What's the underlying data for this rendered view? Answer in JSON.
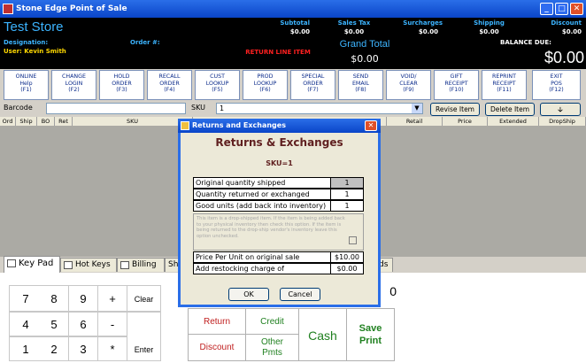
{
  "window": {
    "title": "Stone Edge Point of Sale"
  },
  "header": {
    "store_name": "Test Store",
    "designation_label": "Designation:",
    "order_label": "Order #:",
    "user": "User: Kevin Smith",
    "return_line": "RETURN LINE ITEM",
    "totals": [
      {
        "label": "Subtotal",
        "value": "$0.00"
      },
      {
        "label": "Sales Tax",
        "value": "$0.00"
      },
      {
        "label": "Surcharges",
        "value": "$0.00"
      },
      {
        "label": "Shipping",
        "value": "$0.00"
      },
      {
        "label": "Discount",
        "value": "$0.00"
      }
    ],
    "grand_total_label": "Grand Total",
    "grand_total_value": "$0.00",
    "balance_due_label": "BALANCE DUE:",
    "balance_due_value": "$0.00"
  },
  "function_keys": [
    {
      "l1": "ONLINE",
      "l2": "Help",
      "l3": "(F1)"
    },
    {
      "l1": "CHANGE",
      "l2": "LOGIN",
      "l3": "(F2)"
    },
    {
      "l1": "HOLD",
      "l2": "ORDER",
      "l3": "(F3)"
    },
    {
      "l1": "RECALL",
      "l2": "ORDER",
      "l3": "(F4)"
    },
    {
      "l1": "CUST",
      "l2": "LOOKUP",
      "l3": "(F5)"
    },
    {
      "l1": "PROD",
      "l2": "LOOKUP",
      "l3": "(F6)"
    },
    {
      "l1": "SPECIAL",
      "l2": "ORDER",
      "l3": "(F7)"
    },
    {
      "l1": "SEND",
      "l2": "EMAIL",
      "l3": "(F8)"
    },
    {
      "l1": "VOID/",
      "l2": "CLEAR",
      "l3": "(F9)"
    },
    {
      "l1": "GIFT",
      "l2": "RECEIPT",
      "l3": "(F10)"
    },
    {
      "l1": "REPRINT",
      "l2": "RECEIPT",
      "l3": "(F11)"
    },
    {
      "l1": "EXIT",
      "l2": "POS",
      "l3": "(F12)"
    }
  ],
  "entry": {
    "barcode_label": "Barcode",
    "sku_label": "SKU",
    "sku_value": "1",
    "revise_button": "Revise Item",
    "delete_button": "Delete Item",
    "arrow_glyph": "🡣"
  },
  "grid": {
    "columns": [
      "Ord",
      "Ship",
      "BO",
      "Ret",
      "SKU",
      "",
      "Retail",
      "Price",
      "Extended",
      "DropShip"
    ]
  },
  "tabs": [
    "Key Pad",
    "Hot Keys",
    "Billing",
    "Sh",
    "ds"
  ],
  "keypad": {
    "keys": [
      "7",
      "8",
      "9",
      "+",
      "4",
      "5",
      "6",
      "-",
      "1",
      "2",
      "3",
      "*"
    ],
    "clear": "Clear",
    "enter": "Enter",
    "display": "0"
  },
  "actions": {
    "return": "Return",
    "credit": "Credit",
    "discount": "Discount",
    "other_l1": "Other",
    "other_l2": "Pmts",
    "cash": "Cash",
    "save_l1": "Save",
    "save_l2": "Print"
  },
  "dialog": {
    "title": "Returns and Exchanges",
    "heading": "Returns & Exchanges",
    "sku": "SKU=1",
    "rows": [
      {
        "label": "Original quantity shipped",
        "value": "1"
      },
      {
        "label": "Quantity returned or exchanged",
        "value": "1"
      },
      {
        "label": "Good units (add back into inventory)",
        "value": "1"
      }
    ],
    "dropship_note": "This item is a drop-shipped item. If the item is being added back to your physical inventory then check this option. If the item is being returned to the drop-ship vendor's inventory leave this option unchecked.",
    "price_label": "Price Per Unit on original sale",
    "price_value": "$10.00",
    "restock_label": "Add restocking charge of",
    "restock_value": "$0.00",
    "ok": "OK",
    "cancel": "Cancel"
  }
}
